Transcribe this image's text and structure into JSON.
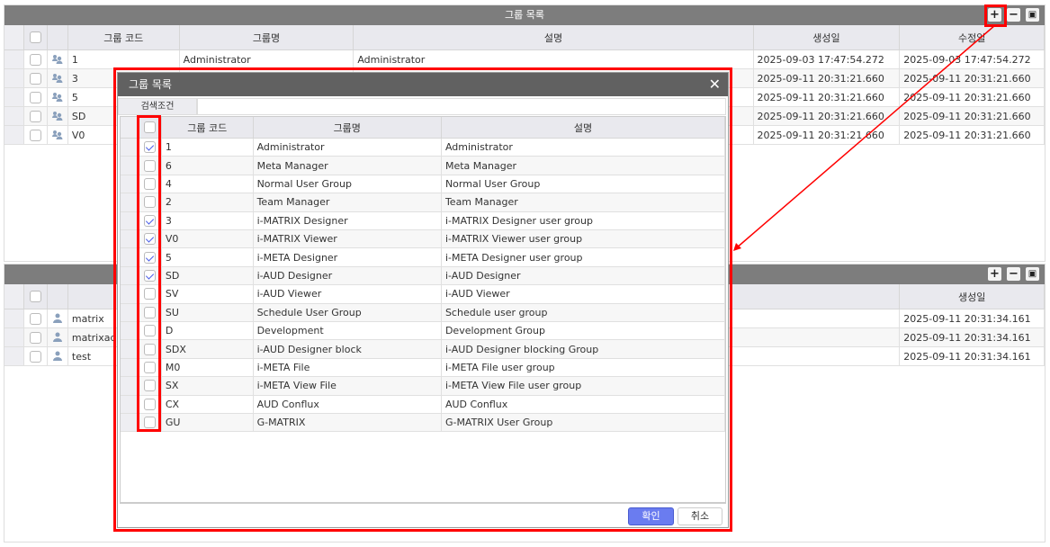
{
  "top_panel": {
    "title": "그룹 목록",
    "columns": [
      "그룹 코드",
      "그룹명",
      "설명",
      "생성일",
      "수정일"
    ],
    "rows": [
      {
        "code": "1",
        "name": "Administrator",
        "desc": "Administrator",
        "created": "2025-09-03 17:47:54.272",
        "modified": "2025-09-03 17:47:54.272"
      },
      {
        "code": "3",
        "name": "",
        "desc": "",
        "created": "2025-09-11 20:31:21.660",
        "modified": "2025-09-11 20:31:21.660"
      },
      {
        "code": "5",
        "name": "",
        "desc": "",
        "created": "2025-09-11 20:31:21.660",
        "modified": "2025-09-11 20:31:21.660"
      },
      {
        "code": "SD",
        "name": "",
        "desc": "",
        "created": "2025-09-11 20:31:21.660",
        "modified": "2025-09-11 20:31:21.660"
      },
      {
        "code": "V0",
        "name": "",
        "desc": "",
        "created": "2025-09-11 20:31:21.660",
        "modified": "2025-09-11 20:31:21.660"
      }
    ]
  },
  "bottom_panel": {
    "columns": [
      "생성일"
    ],
    "rows": [
      {
        "id": "matrix",
        "created": "2025-09-11 20:31:34.161"
      },
      {
        "id": "matrixadm",
        "created": "2025-09-11 20:31:34.161"
      },
      {
        "id": "test",
        "created": "2025-09-11 20:31:34.161"
      }
    ]
  },
  "modal": {
    "title": "그룹 목록",
    "tab": "검색조건",
    "columns": [
      "그룹 코드",
      "그룹명",
      "설명"
    ],
    "ok": "확인",
    "cancel": "취소",
    "rows": [
      {
        "checked": true,
        "code": "1",
        "name": "Administrator",
        "desc": "Administrator"
      },
      {
        "checked": false,
        "code": "6",
        "name": "Meta Manager",
        "desc": "Meta Manager"
      },
      {
        "checked": false,
        "code": "4",
        "name": "Normal User Group",
        "desc": "Normal User Group"
      },
      {
        "checked": false,
        "code": "2",
        "name": "Team Manager",
        "desc": "Team Manager"
      },
      {
        "checked": true,
        "code": "3",
        "name": "i-MATRIX Designer",
        "desc": "i-MATRIX Designer user group"
      },
      {
        "checked": true,
        "code": "V0",
        "name": "i-MATRIX Viewer",
        "desc": "i-MATRIX Viewer user group"
      },
      {
        "checked": true,
        "code": "5",
        "name": "i-META Designer",
        "desc": "i-META Designer user group"
      },
      {
        "checked": true,
        "code": "SD",
        "name": "i-AUD Designer",
        "desc": "i-AUD Designer"
      },
      {
        "checked": false,
        "code": "SV",
        "name": "i-AUD Viewer",
        "desc": "i-AUD Viewer"
      },
      {
        "checked": false,
        "code": "SU",
        "name": "Schedule User Group",
        "desc": "Schedule user group"
      },
      {
        "checked": false,
        "code": "D",
        "name": "Development",
        "desc": "Development Group"
      },
      {
        "checked": false,
        "code": "SDX",
        "name": "i-AUD Designer block",
        "desc": "i-AUD Designer blocking Group"
      },
      {
        "checked": false,
        "code": "M0",
        "name": "i-META File",
        "desc": "i-META File user group"
      },
      {
        "checked": false,
        "code": "SX",
        "name": "i-META View File",
        "desc": "i-META View File user group"
      },
      {
        "checked": false,
        "code": "CX",
        "name": "AUD Conflux",
        "desc": "AUD Conflux"
      },
      {
        "checked": false,
        "code": "GU",
        "name": "G-MATRIX",
        "desc": "G-MATRIX User Group"
      }
    ]
  },
  "colors": {
    "accent": "#6a7cf0",
    "highlight": "#ff0000",
    "header": "#7d7d7d"
  }
}
